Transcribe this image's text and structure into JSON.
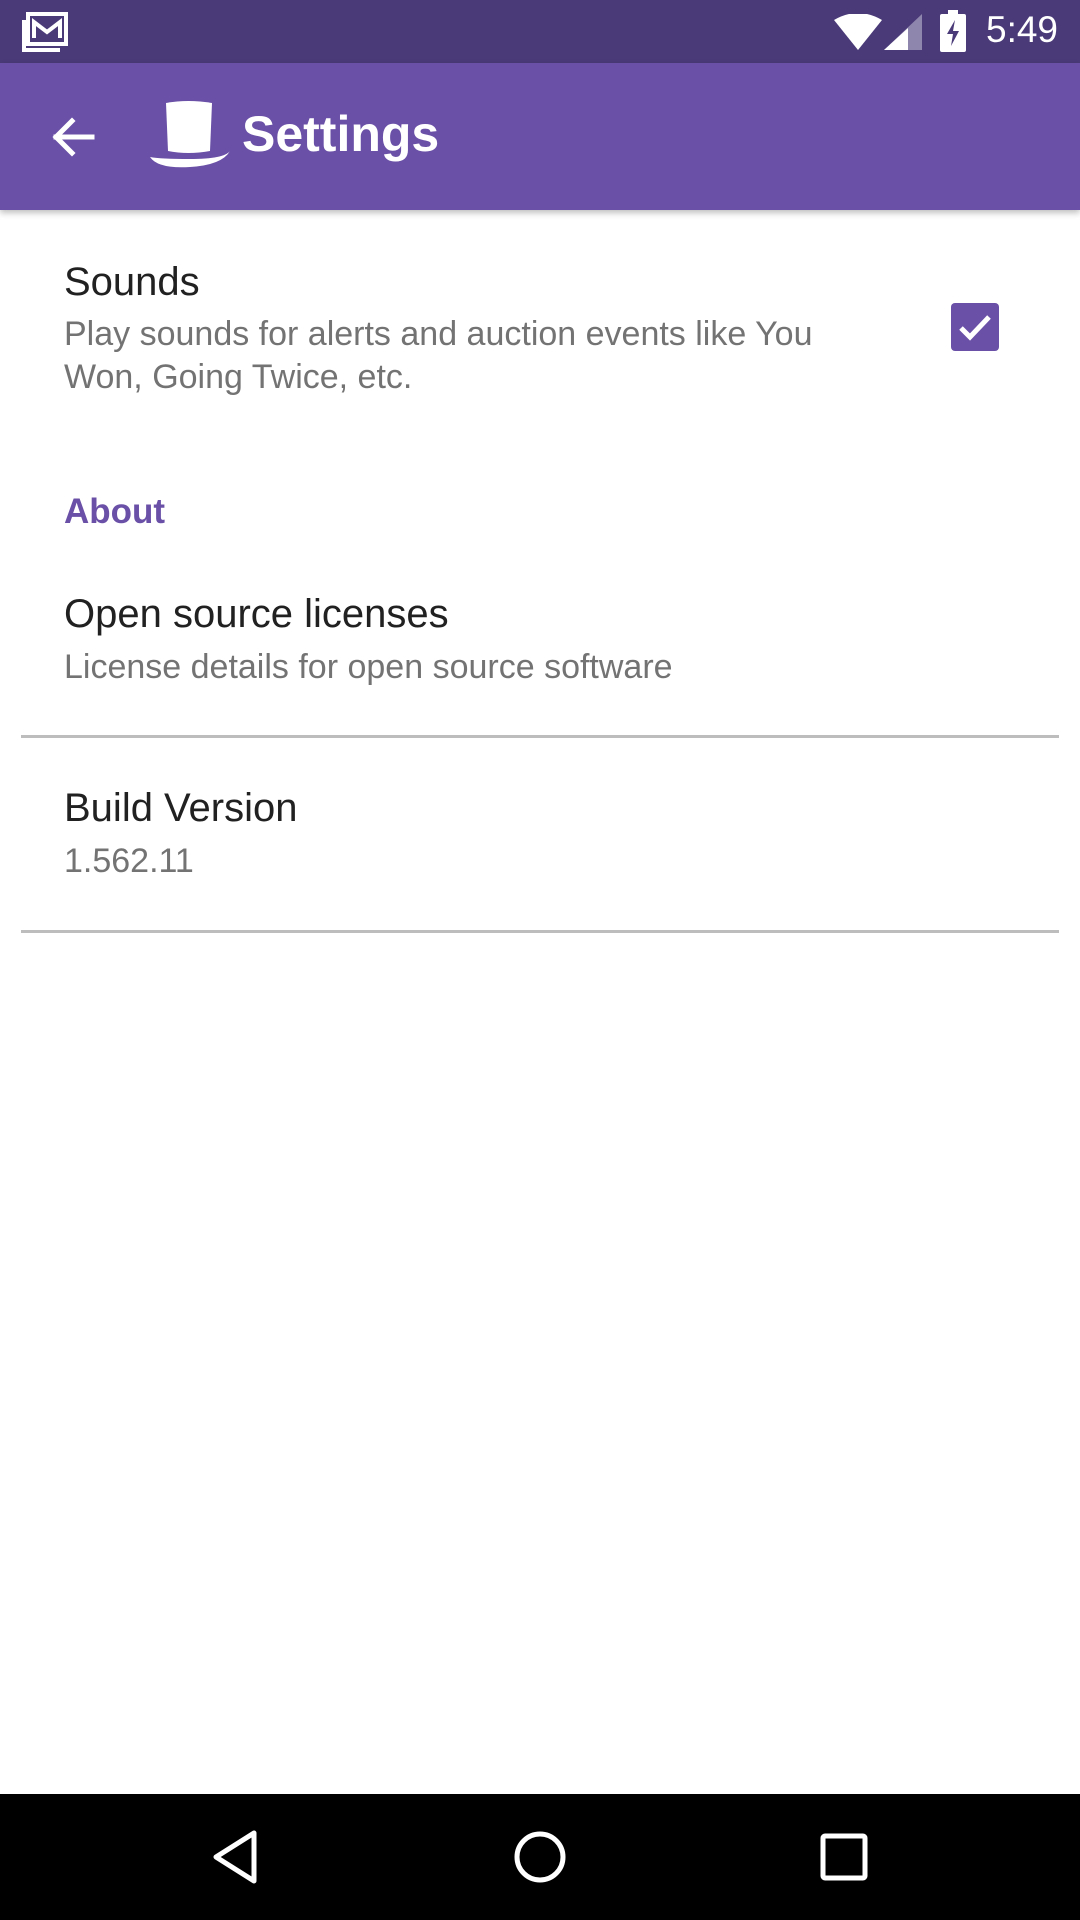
{
  "status_bar": {
    "time": "5:49",
    "icons": [
      "gmail-notification-icon",
      "wifi-icon",
      "cell-signal-icon",
      "battery-charging-icon"
    ]
  },
  "app_bar": {
    "title": "Settings",
    "back_icon": "arrow-back-icon",
    "logo_icon": "top-hat-icon",
    "color": "#6a50a7"
  },
  "prefs": {
    "sounds": {
      "title": "Sounds",
      "summary_line1": "Play sounds for alerts and auction events like You",
      "summary_line2": "Won, Going Twice, etc.",
      "checked": true
    },
    "about_category": "About",
    "licenses": {
      "title": "Open source licenses",
      "summary": "License details for open source software"
    },
    "build": {
      "title": "Build Version",
      "summary": "1.562.11"
    }
  },
  "nav_bar": {
    "icons": [
      "back-triangle-icon",
      "home-circle-icon",
      "recents-square-icon"
    ]
  },
  "colors": {
    "status_bar": "#4a3a78",
    "accent": "#6a50a7"
  }
}
